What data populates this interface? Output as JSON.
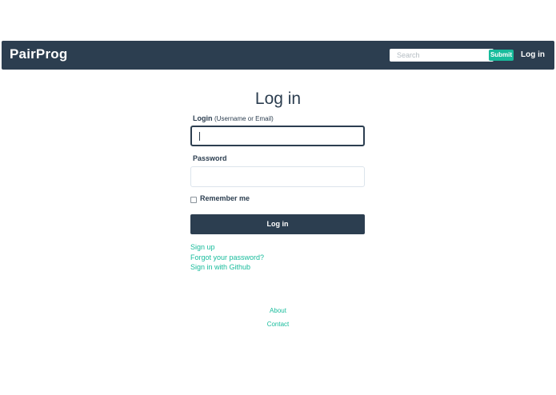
{
  "navbar": {
    "brand": "PairProg",
    "search": {
      "placeholder": "Search",
      "value": ""
    },
    "submit_label": "Submit",
    "login_link": "Log in"
  },
  "form": {
    "title": "Log in",
    "login_label": "Login",
    "login_hint": "(Username or Email)",
    "login_value": "",
    "password_label": "Password",
    "password_value": "",
    "remember_label": "Remember me",
    "remember_checked": false,
    "submit_label": "Log in"
  },
  "links": {
    "sign_up": "Sign up",
    "forgot_password": "Forgot your password?",
    "github": "Sign in with Github"
  },
  "footer": {
    "about": "About",
    "contact": "Contact"
  },
  "colors": {
    "primary": "#2c3e50",
    "accent": "#18bc9c",
    "background": "#ffffff",
    "input_border": "#dce4ec"
  }
}
